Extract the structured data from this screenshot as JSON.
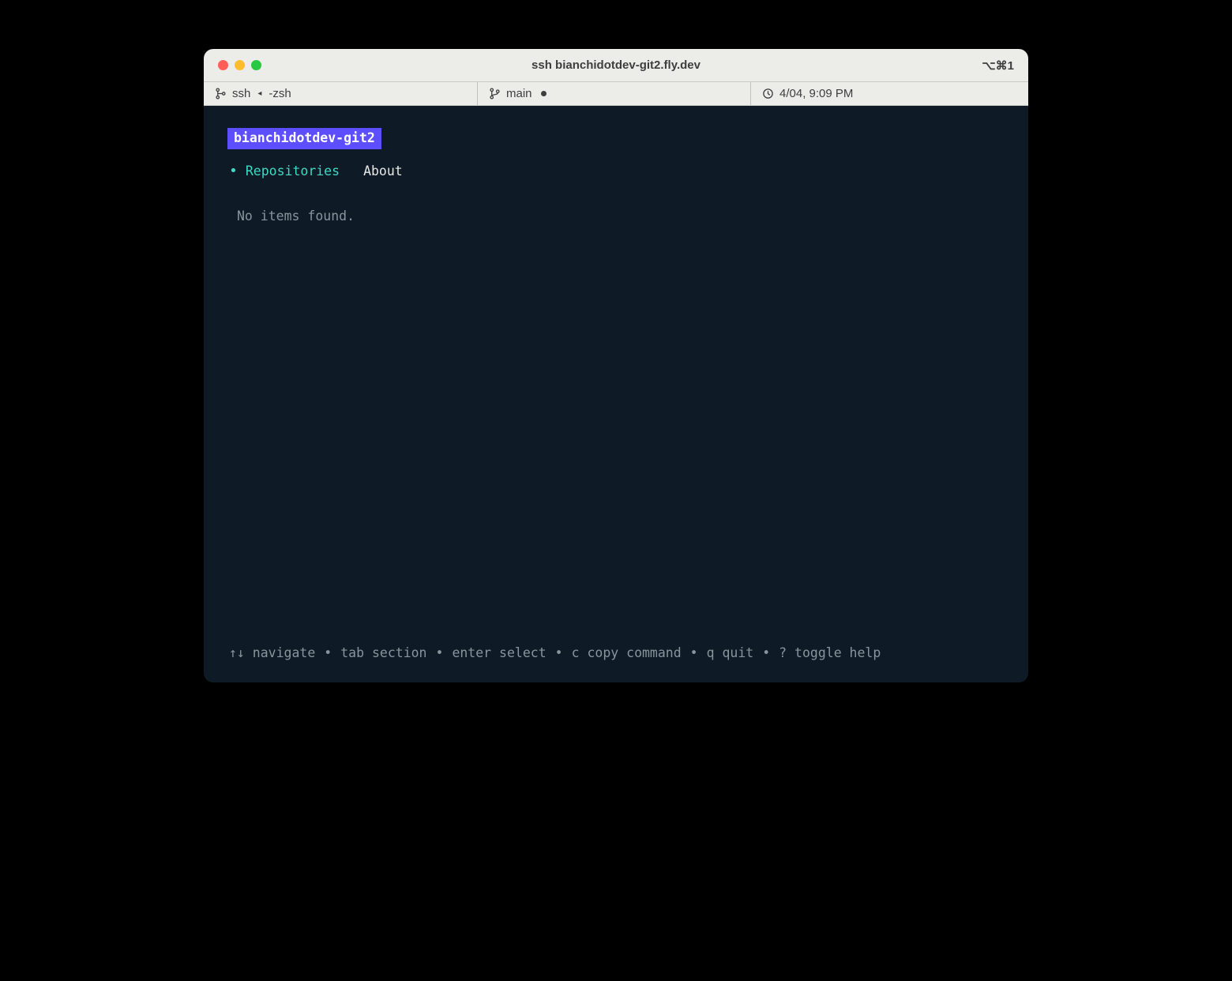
{
  "window": {
    "title": "ssh bianchidotdev-git2.fly.dev",
    "right_indicator": "⌥⌘1"
  },
  "statusbar": {
    "left": {
      "process": "ssh",
      "shell": "-zsh"
    },
    "mid": {
      "branch": "main"
    },
    "right": {
      "timestamp": "4/04, 9:09 PM"
    }
  },
  "terminal": {
    "host": "bianchidotdev-git2",
    "tabs": [
      {
        "label": "Repositories",
        "active": true
      },
      {
        "label": "About",
        "active": false
      }
    ],
    "empty_message": "No items found."
  },
  "help": {
    "items": [
      "↑↓ navigate",
      "tab section",
      "enter select",
      "c copy command",
      "q quit",
      "? toggle help"
    ],
    "separator": "•"
  }
}
